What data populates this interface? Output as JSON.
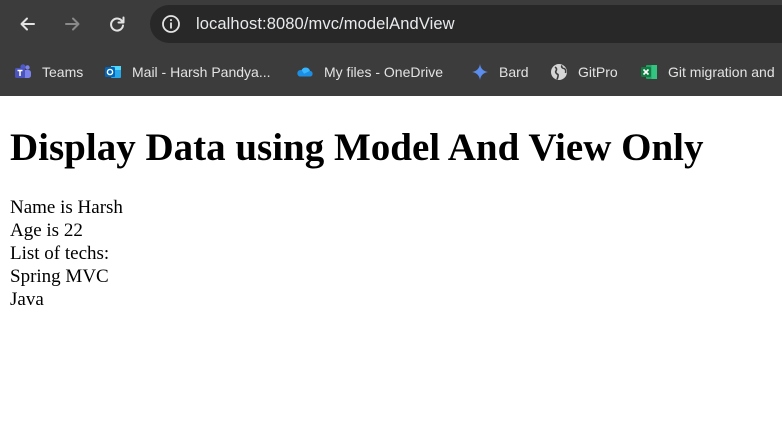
{
  "browser": {
    "url": "localhost:8080/mvc/modelAndView",
    "bookmarks": [
      {
        "label": "Teams",
        "icon": "teams-icon"
      },
      {
        "label": "Mail - Harsh Pandya...",
        "icon": "outlook-icon"
      },
      {
        "label": "My files - OneDrive",
        "icon": "onedrive-icon"
      },
      {
        "label": "Bard",
        "icon": "bard-icon"
      },
      {
        "label": "GitPro",
        "icon": "globe-icon"
      },
      {
        "label": "Git migration and",
        "icon": "excel-icon"
      }
    ],
    "colors": {
      "chrome_bg": "#3c3c3c",
      "omnibox_bg": "#282828",
      "text": "#e3e3e3"
    }
  },
  "page": {
    "heading": "Display Data using Model And View Only",
    "name_line": "Name is Harsh",
    "age_line": "Age is 22",
    "techs_label": "List of techs:",
    "techs": [
      "Spring MVC",
      "Java"
    ]
  }
}
